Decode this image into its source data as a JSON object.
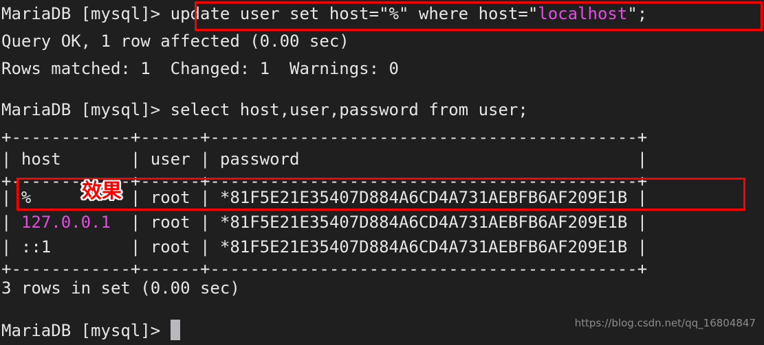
{
  "terminal": {
    "background_color": "#1f1f1f",
    "foreground_color": "#e6e6e6",
    "highlight_color": "#e84ae8",
    "annotation_color": "#ff0000",
    "lines": {
      "l1_prompt": "MariaDB [mysql]> ",
      "l1_cmd_a": "update user set host=\"%\" where host=\"",
      "l1_cmd_host": "localhost",
      "l1_cmd_b": "\";",
      "l2": "Query OK, 1 row affected (0.00 sec)",
      "l3": "Rows matched: 1  Changed: 1  Warnings: 0",
      "l5_prompt": "MariaDB [mysql]> ",
      "l5_cmd": "select host,user,password from user;",
      "l6_sep": "+------------+------+-------------------------------------------+",
      "l7_header": "| host       | user | password                                  |",
      "l8_sep": "+------------+------+-------------------------------------------+",
      "l9_row": "| %          | root | *81F5E21E35407D884A6CD4A731AEBFB6AF209E1B |",
      "l10_row_pre": "| ",
      "l10_row_host": "127.0.0.1",
      "l10_row_post": "  | root | *81F5E21E35407D884A6CD4A731AEBFB6AF209E1B |",
      "l11_row": "| ::1        | root | *81F5E21E35407D884A6CD4A731AEBFB6AF209E1B |",
      "l12_sep": "+------------+------+-------------------------------------------+",
      "l13": "3 rows in set (0.00 sec)",
      "l15_prompt": "MariaDB [mysql]> "
    },
    "table": {
      "columns": [
        "host",
        "user",
        "password"
      ],
      "rows": [
        [
          "%",
          "root",
          "*81F5E21E35407D884A6CD4A731AEBFB6AF209E1B"
        ],
        [
          "127.0.0.1",
          "root",
          "*81F5E21E35407D884A6CD4A731AEBFB6AF209E1B"
        ],
        [
          "::1",
          "root",
          "*81F5E21E35407D884A6CD4A731AEBFB6AF209E1B"
        ]
      ],
      "row_count_text": "3 rows in set (0.00 sec)"
    }
  },
  "annotations": {
    "effect_label": "效果"
  },
  "watermark": {
    "text": "https://blog.csdn.net/qq_16804847"
  }
}
